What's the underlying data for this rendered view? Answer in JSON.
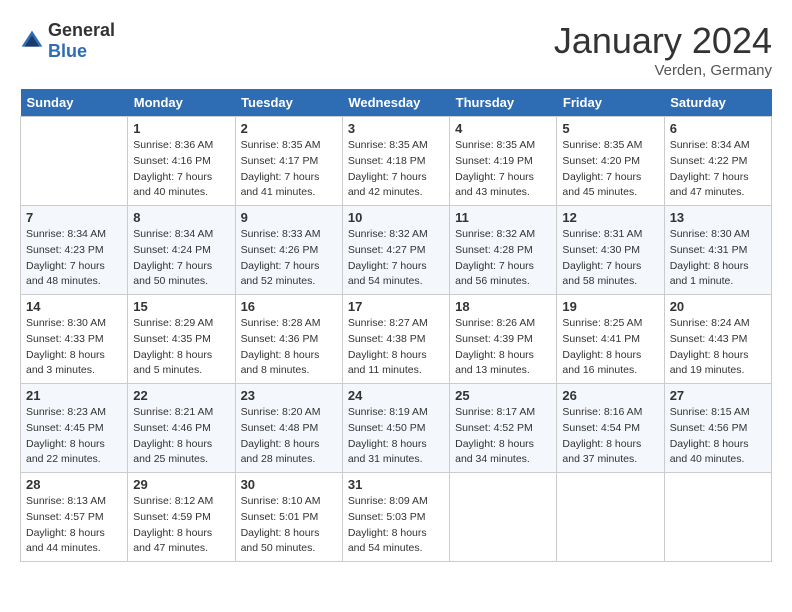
{
  "header": {
    "logo_general": "General",
    "logo_blue": "Blue",
    "month_title": "January 2024",
    "location": "Verden, Germany"
  },
  "weekdays": [
    "Sunday",
    "Monday",
    "Tuesday",
    "Wednesday",
    "Thursday",
    "Friday",
    "Saturday"
  ],
  "weeks": [
    [
      {
        "day": "",
        "sunrise": "",
        "sunset": "",
        "daylight": ""
      },
      {
        "day": "1",
        "sunrise": "Sunrise: 8:36 AM",
        "sunset": "Sunset: 4:16 PM",
        "daylight": "Daylight: 7 hours and 40 minutes."
      },
      {
        "day": "2",
        "sunrise": "Sunrise: 8:35 AM",
        "sunset": "Sunset: 4:17 PM",
        "daylight": "Daylight: 7 hours and 41 minutes."
      },
      {
        "day": "3",
        "sunrise": "Sunrise: 8:35 AM",
        "sunset": "Sunset: 4:18 PM",
        "daylight": "Daylight: 7 hours and 42 minutes."
      },
      {
        "day": "4",
        "sunrise": "Sunrise: 8:35 AM",
        "sunset": "Sunset: 4:19 PM",
        "daylight": "Daylight: 7 hours and 43 minutes."
      },
      {
        "day": "5",
        "sunrise": "Sunrise: 8:35 AM",
        "sunset": "Sunset: 4:20 PM",
        "daylight": "Daylight: 7 hours and 45 minutes."
      },
      {
        "day": "6",
        "sunrise": "Sunrise: 8:34 AM",
        "sunset": "Sunset: 4:22 PM",
        "daylight": "Daylight: 7 hours and 47 minutes."
      }
    ],
    [
      {
        "day": "7",
        "sunrise": "Sunrise: 8:34 AM",
        "sunset": "Sunset: 4:23 PM",
        "daylight": "Daylight: 7 hours and 48 minutes."
      },
      {
        "day": "8",
        "sunrise": "Sunrise: 8:34 AM",
        "sunset": "Sunset: 4:24 PM",
        "daylight": "Daylight: 7 hours and 50 minutes."
      },
      {
        "day": "9",
        "sunrise": "Sunrise: 8:33 AM",
        "sunset": "Sunset: 4:26 PM",
        "daylight": "Daylight: 7 hours and 52 minutes."
      },
      {
        "day": "10",
        "sunrise": "Sunrise: 8:32 AM",
        "sunset": "Sunset: 4:27 PM",
        "daylight": "Daylight: 7 hours and 54 minutes."
      },
      {
        "day": "11",
        "sunrise": "Sunrise: 8:32 AM",
        "sunset": "Sunset: 4:28 PM",
        "daylight": "Daylight: 7 hours and 56 minutes."
      },
      {
        "day": "12",
        "sunrise": "Sunrise: 8:31 AM",
        "sunset": "Sunset: 4:30 PM",
        "daylight": "Daylight: 7 hours and 58 minutes."
      },
      {
        "day": "13",
        "sunrise": "Sunrise: 8:30 AM",
        "sunset": "Sunset: 4:31 PM",
        "daylight": "Daylight: 8 hours and 1 minute."
      }
    ],
    [
      {
        "day": "14",
        "sunrise": "Sunrise: 8:30 AM",
        "sunset": "Sunset: 4:33 PM",
        "daylight": "Daylight: 8 hours and 3 minutes."
      },
      {
        "day": "15",
        "sunrise": "Sunrise: 8:29 AM",
        "sunset": "Sunset: 4:35 PM",
        "daylight": "Daylight: 8 hours and 5 minutes."
      },
      {
        "day": "16",
        "sunrise": "Sunrise: 8:28 AM",
        "sunset": "Sunset: 4:36 PM",
        "daylight": "Daylight: 8 hours and 8 minutes."
      },
      {
        "day": "17",
        "sunrise": "Sunrise: 8:27 AM",
        "sunset": "Sunset: 4:38 PM",
        "daylight": "Daylight: 8 hours and 11 minutes."
      },
      {
        "day": "18",
        "sunrise": "Sunrise: 8:26 AM",
        "sunset": "Sunset: 4:39 PM",
        "daylight": "Daylight: 8 hours and 13 minutes."
      },
      {
        "day": "19",
        "sunrise": "Sunrise: 8:25 AM",
        "sunset": "Sunset: 4:41 PM",
        "daylight": "Daylight: 8 hours and 16 minutes."
      },
      {
        "day": "20",
        "sunrise": "Sunrise: 8:24 AM",
        "sunset": "Sunset: 4:43 PM",
        "daylight": "Daylight: 8 hours and 19 minutes."
      }
    ],
    [
      {
        "day": "21",
        "sunrise": "Sunrise: 8:23 AM",
        "sunset": "Sunset: 4:45 PM",
        "daylight": "Daylight: 8 hours and 22 minutes."
      },
      {
        "day": "22",
        "sunrise": "Sunrise: 8:21 AM",
        "sunset": "Sunset: 4:46 PM",
        "daylight": "Daylight: 8 hours and 25 minutes."
      },
      {
        "day": "23",
        "sunrise": "Sunrise: 8:20 AM",
        "sunset": "Sunset: 4:48 PM",
        "daylight": "Daylight: 8 hours and 28 minutes."
      },
      {
        "day": "24",
        "sunrise": "Sunrise: 8:19 AM",
        "sunset": "Sunset: 4:50 PM",
        "daylight": "Daylight: 8 hours and 31 minutes."
      },
      {
        "day": "25",
        "sunrise": "Sunrise: 8:17 AM",
        "sunset": "Sunset: 4:52 PM",
        "daylight": "Daylight: 8 hours and 34 minutes."
      },
      {
        "day": "26",
        "sunrise": "Sunrise: 8:16 AM",
        "sunset": "Sunset: 4:54 PM",
        "daylight": "Daylight: 8 hours and 37 minutes."
      },
      {
        "day": "27",
        "sunrise": "Sunrise: 8:15 AM",
        "sunset": "Sunset: 4:56 PM",
        "daylight": "Daylight: 8 hours and 40 minutes."
      }
    ],
    [
      {
        "day": "28",
        "sunrise": "Sunrise: 8:13 AM",
        "sunset": "Sunset: 4:57 PM",
        "daylight": "Daylight: 8 hours and 44 minutes."
      },
      {
        "day": "29",
        "sunrise": "Sunrise: 8:12 AM",
        "sunset": "Sunset: 4:59 PM",
        "daylight": "Daylight: 8 hours and 47 minutes."
      },
      {
        "day": "30",
        "sunrise": "Sunrise: 8:10 AM",
        "sunset": "Sunset: 5:01 PM",
        "daylight": "Daylight: 8 hours and 50 minutes."
      },
      {
        "day": "31",
        "sunrise": "Sunrise: 8:09 AM",
        "sunset": "Sunset: 5:03 PM",
        "daylight": "Daylight: 8 hours and 54 minutes."
      },
      {
        "day": "",
        "sunrise": "",
        "sunset": "",
        "daylight": ""
      },
      {
        "day": "",
        "sunrise": "",
        "sunset": "",
        "daylight": ""
      },
      {
        "day": "",
        "sunrise": "",
        "sunset": "",
        "daylight": ""
      }
    ]
  ]
}
